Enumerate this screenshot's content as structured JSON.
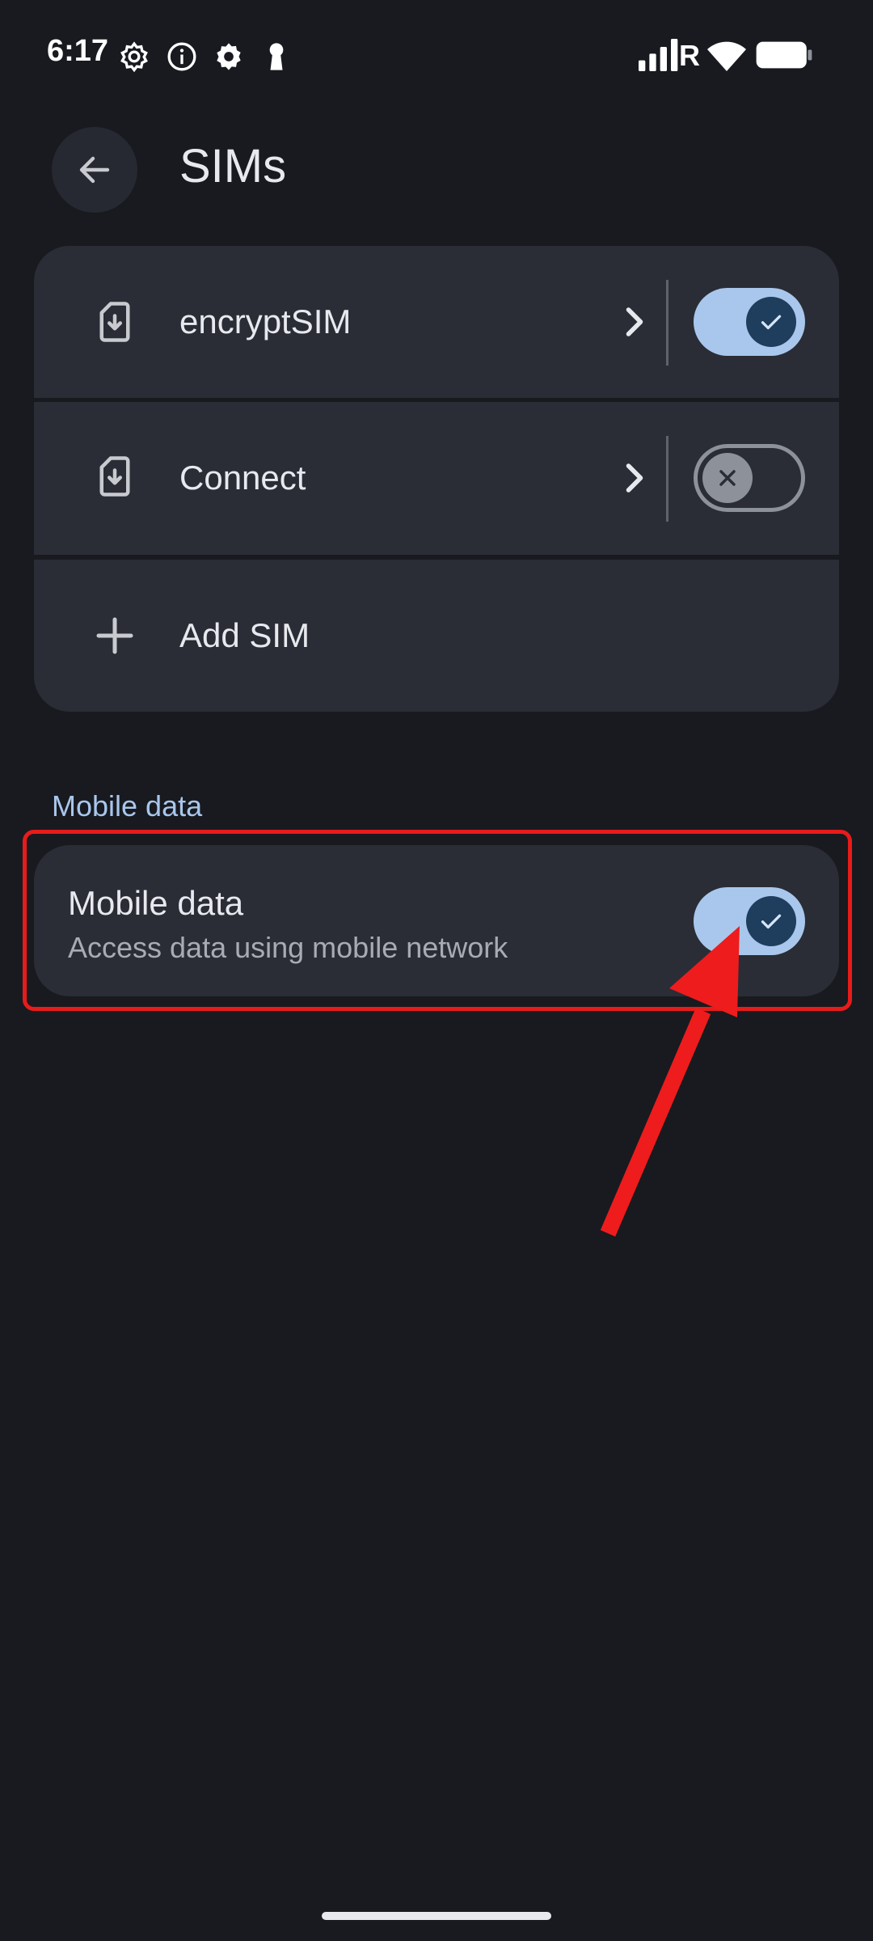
{
  "status_bar": {
    "time": "6:17",
    "left_icons": [
      "settings-gear-icon",
      "info-icon",
      "settings-icon",
      "keyhole-icon"
    ],
    "right_icons": [
      "signal-icon",
      "wifi-icon",
      "battery-icon"
    ],
    "roaming_letter": "R"
  },
  "header": {
    "back_icon": "arrow-left-icon",
    "title": "SIMs"
  },
  "sims": [
    {
      "name": "encryptSIM",
      "icon": "sim-download-icon",
      "enabled": true
    },
    {
      "name": "Connect",
      "icon": "sim-download-icon",
      "enabled": false
    }
  ],
  "add_sim": {
    "icon": "plus-icon",
    "label": "Add SIM"
  },
  "mobile_data_section": {
    "title": "Mobile data",
    "item": {
      "title": "Mobile data",
      "subtitle": "Access data using mobile network",
      "enabled": true
    }
  },
  "colors": {
    "background": "#181a1f",
    "card": "#2a2d35",
    "accent": "#a9c7ec",
    "toggle_knob_on": "#1f3d5c",
    "annotation": "#e81b1b"
  }
}
